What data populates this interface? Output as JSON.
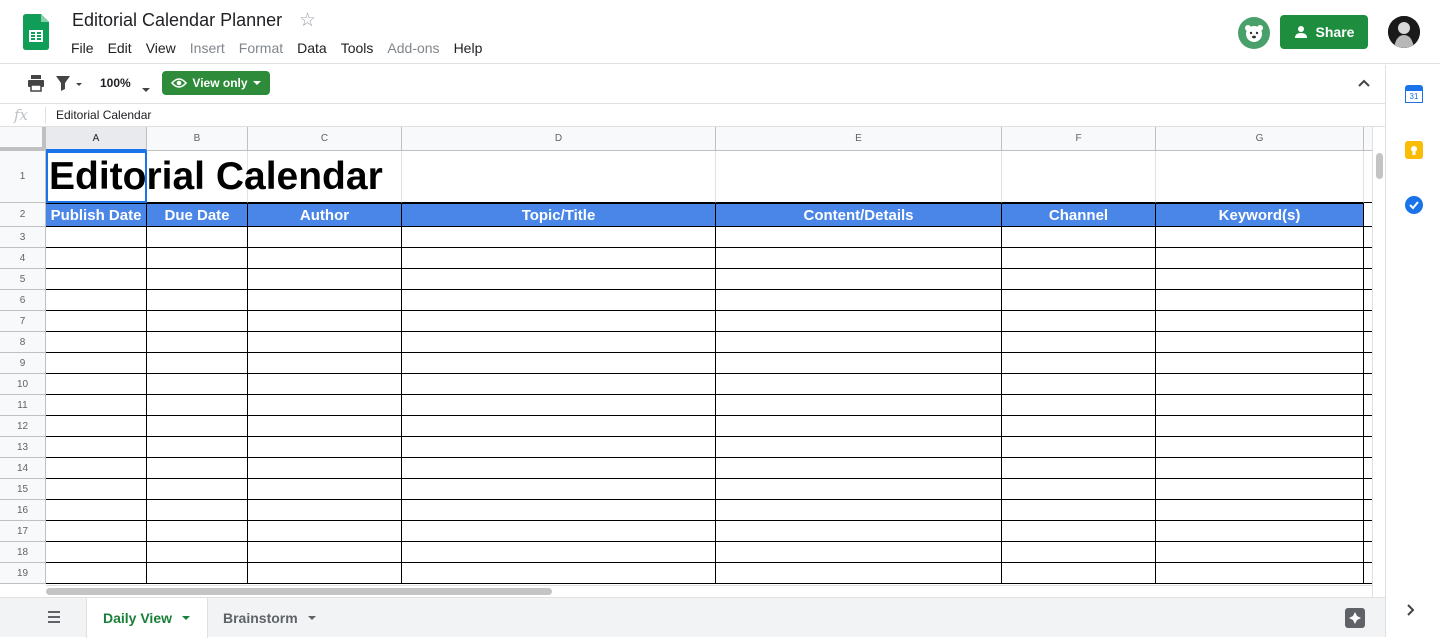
{
  "app": {
    "doc_title": "Editorial Calendar Planner",
    "menu": [
      {
        "label": "File",
        "disabled": false
      },
      {
        "label": "Edit",
        "disabled": false
      },
      {
        "label": "View",
        "disabled": false
      },
      {
        "label": "Insert",
        "disabled": true
      },
      {
        "label": "Format",
        "disabled": true
      },
      {
        "label": "Data",
        "disabled": false
      },
      {
        "label": "Tools",
        "disabled": false
      },
      {
        "label": "Add-ons",
        "disabled": true
      },
      {
        "label": "Help",
        "disabled": false
      }
    ],
    "share_label": "Share",
    "accent_color": "#1e8e3e"
  },
  "toolbar": {
    "zoom": "100%",
    "view_mode": "View only"
  },
  "formula_bar": {
    "fx": "fx",
    "content": "Editorial Calendar"
  },
  "sheet": {
    "columns": [
      "A",
      "B",
      "C",
      "D",
      "E",
      "F",
      "G"
    ],
    "rows": [
      "1",
      "2",
      "3",
      "4",
      "5",
      "6",
      "7",
      "8",
      "9",
      "10",
      "11",
      "12",
      "13",
      "14",
      "15",
      "16",
      "17",
      "18",
      "19"
    ],
    "title": "Editorial Calendar",
    "headers": [
      "Publish Date",
      "Due Date",
      "Author",
      "Topic/Title",
      "Content/Details",
      "Channel",
      "Keyword(s)"
    ],
    "header_color": "#4a86e8",
    "selected_cell": "A1"
  },
  "tabs": [
    {
      "label": "Daily View",
      "active": true
    },
    {
      "label": "Brainstorm",
      "active": false
    }
  ],
  "side_panel": {
    "calendar_badge": "31"
  }
}
